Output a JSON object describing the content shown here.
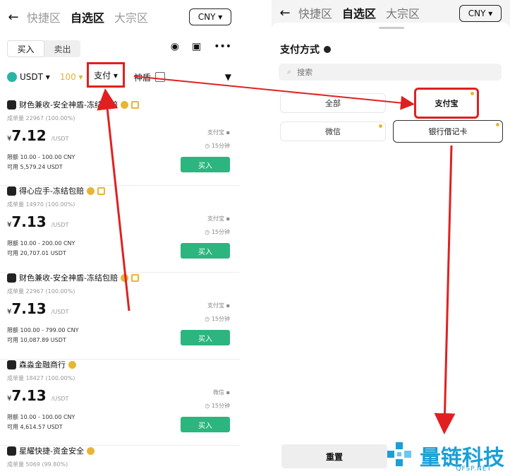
{
  "left": {
    "nav": {
      "back": "←",
      "tabs": [
        "快捷区",
        "自选区",
        "大宗区"
      ],
      "currency": "CNY ▾"
    },
    "toggle": [
      "买入",
      "卖出"
    ],
    "filter": {
      "coin": "USDT ▾",
      "amount": "100 ▾",
      "payment": "支付 ▾",
      "shield": "神盾"
    },
    "listings": [
      {
        "merchant": "财色兼收-安全神盾-冻结包赔",
        "stats": "成单量 22967 (100.00%)",
        "price": "7.12",
        "limit": "限额 10.00 - 100.00 CNY",
        "available": "可用 5,579.24 USDT",
        "payment": "支付宝 ▪",
        "time": "◷ 15分钟",
        "buy": "买入"
      },
      {
        "merchant": "得心应手-冻结包赔",
        "stats": "成单量 14970 (100.00%)",
        "price": "7.13",
        "limit": "限额 10.00 - 200.00 CNY",
        "available": "可用 20,707.01 USDT",
        "payment": "支付宝 ▪",
        "time": "◷ 15分钟",
        "buy": "买入"
      },
      {
        "merchant": "财色兼收-安全神盾-冻结包赔",
        "stats": "成单量 22967 (100.00%)",
        "price": "7.13",
        "limit": "限额 100.00 - 799.00 CNY",
        "available": "可用 10,087.89 USDT",
        "payment": "支付宝 ▪",
        "time": "◷ 15分钟",
        "buy": "买入"
      },
      {
        "merchant": "森淼金融商行",
        "stats": "成单量 18427 (100.00%)",
        "price": "7.13",
        "limit": "限额 10.00 - 100.00 CNY",
        "available": "可用 4,614.57 USDT",
        "payment": "微信 ▪",
        "time": "◷ 15分钟",
        "buy": "买入"
      },
      {
        "merchant": "星耀快捷-资金安全",
        "stats": "成单量 5069 (99.80%)"
      }
    ],
    "currency_symbol": "¥",
    "unit": "/USDT"
  },
  "right": {
    "nav": {
      "back": "←",
      "tabs": [
        "快捷区",
        "自选区",
        "大宗区"
      ],
      "currency": "CNY ▾"
    },
    "sheet_title": "支付方式",
    "search_placeholder": "搜索",
    "options": {
      "all": "全部",
      "alipay": "支付宝",
      "wechat": "微信",
      "bank": "银行借记卡"
    },
    "reset": "重置"
  },
  "watermark": {
    "text": "量链科技",
    "sub": "QFSP.NET"
  },
  "colors": {
    "buy": "#2cb57f",
    "highlight": "#e02020",
    "accent": "#e8b536",
    "watermark": "#1a9fd6"
  }
}
